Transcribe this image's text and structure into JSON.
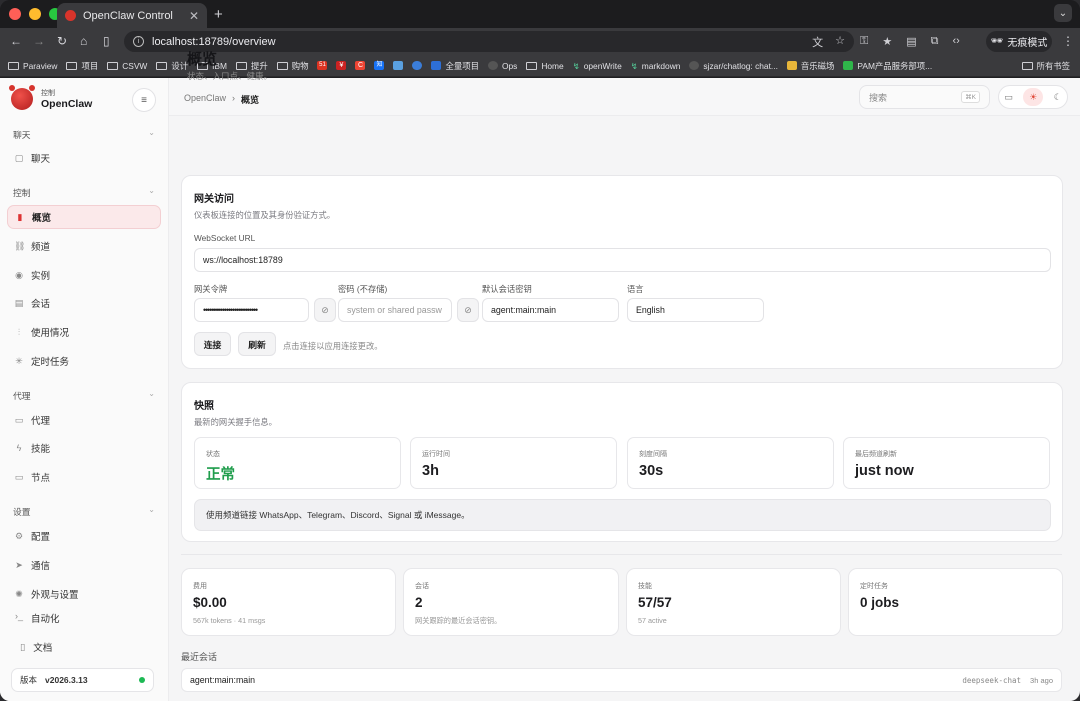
{
  "browser": {
    "tab_title": "OpenClaw Control",
    "new_tab": "+",
    "url": "localhost:18789/overview",
    "incognito_label": "无痕模式",
    "bookmarks": [
      "Paraview",
      "项目",
      "CSVW",
      "设计",
      "IBM",
      "提升",
      "购物",
      "51",
      "¥",
      "C",
      "知",
      "全量项目",
      "Ops",
      "Home",
      "openWrite",
      "markdown",
      "sjzar/chatlog: chat...",
      "音乐磁场",
      "PAM产品服务部项..."
    ],
    "bookmarks_right": "所有书签"
  },
  "sidebar": {
    "brand_sub": "控制",
    "brand_name": "OpenClaw",
    "groups": {
      "chat": "聊天",
      "control": "控制",
      "agent": "代理",
      "settings": "设置"
    },
    "items": {
      "chat": "聊天",
      "overview": "概览",
      "channels": "频道",
      "instances": "实例",
      "sessions": "会话",
      "usage": "使用情况",
      "cron": "定时任务",
      "agents": "代理",
      "skills": "技能",
      "nodes": "节点",
      "config": "配置",
      "comm": "通信",
      "appearance": "外观与设置",
      "automation": "自动化"
    },
    "docs": "文档",
    "version_label": "版本",
    "version": "v2026.3.13"
  },
  "topbar": {
    "crumb_root": "OpenClaw",
    "crumb_sep": "›",
    "crumb_current": "概览",
    "search_placeholder": "搜索",
    "search_kbd": "⌘K"
  },
  "page": {
    "title": "概览",
    "subtitle": "状态、入口点、健康。"
  },
  "gateway": {
    "title": "网关访问",
    "subtitle": "仪表板连接的位置及其身份验证方式。",
    "ws_label": "WebSocket URL",
    "ws_value": "ws://localhost:18789",
    "token_label": "网关令牌",
    "token_value": "••••••••••••••••••••••••••",
    "password_label": "密码 (不存储)",
    "password_placeholder": "system or shared passw",
    "session_label": "默认会话密钥",
    "session_value": "agent:main:main",
    "lang_label": "语言",
    "lang_value": "English",
    "connect": "连接",
    "refresh": "刷新",
    "hint": "点击连接以应用连接更改。"
  },
  "snapshot": {
    "title": "快照",
    "subtitle": "最新的网关握手信息。",
    "stats": [
      {
        "k": "状态",
        "v": "正常"
      },
      {
        "k": "运行时间",
        "v": "3h"
      },
      {
        "k": "刻度间隔",
        "v": "30s"
      },
      {
        "k": "最后频道刷新",
        "v": "just now"
      }
    ],
    "note": "使用频道链接 WhatsApp、Telegram、Discord、Signal 或 iMessage。"
  },
  "metrics": [
    {
      "k": "费用",
      "v": "$0.00",
      "s": "567k tokens · 41 msgs"
    },
    {
      "k": "会话",
      "v": "2",
      "s": "网关跟踪的最近会话密钥。"
    },
    {
      "k": "技能",
      "v": "57/57",
      "s": "57 active"
    },
    {
      "k": "定时任务",
      "v": "0 jobs",
      "s": ""
    }
  ],
  "recent": {
    "title": "最近会话",
    "rows": [
      {
        "key": "agent:main:main",
        "model": "deepseek-chat",
        "ago": "3h ago"
      }
    ]
  },
  "colors": {
    "accent": "#e04a3a",
    "ok": "#1f9d4c",
    "active_bg": "#fbe9ea"
  }
}
